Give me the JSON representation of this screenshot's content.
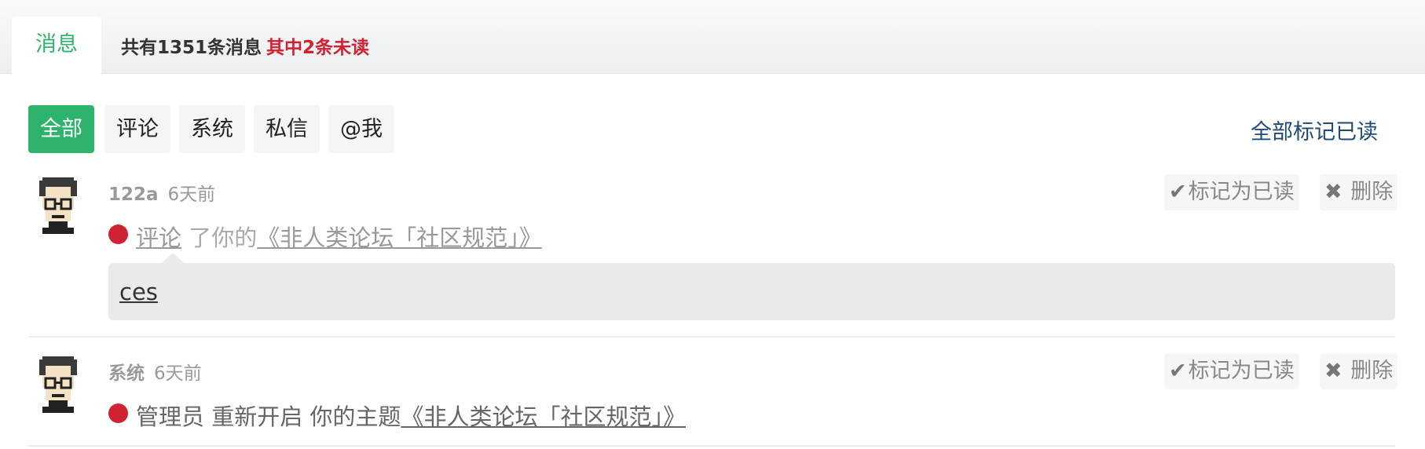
{
  "header": {
    "tab_label": "消息",
    "summary_total": "共有1351条消息",
    "summary_unread": "其中2条未读"
  },
  "filters": {
    "items": [
      "全部",
      "评论",
      "系统",
      "私信",
      "@我"
    ],
    "active": "全部",
    "mark_all_read": "全部标记已读"
  },
  "messages": [
    {
      "user": "122a",
      "time": "6天前",
      "unread": true,
      "action_link": "评论",
      "text": " 了你的",
      "topic": "《非人类论坛「社区规范」》",
      "comment": "ces",
      "mark_read_label": "标记为已读",
      "delete_label": "删除"
    },
    {
      "user": "系统",
      "time": "6天前",
      "unread": true,
      "text": "管理员 重新开启 你的主题",
      "topic": "《非人类论坛「社区规范」》",
      "mark_read_label": "标记为已读",
      "delete_label": "删除"
    }
  ],
  "colors": {
    "accent_green": "#2db36b",
    "unread_red": "#cf2232",
    "link_blue": "#1e4a76"
  },
  "icons": {
    "check": "check-icon",
    "delete": "close-x-icon",
    "avatar": "pixel-avatar-icon"
  }
}
